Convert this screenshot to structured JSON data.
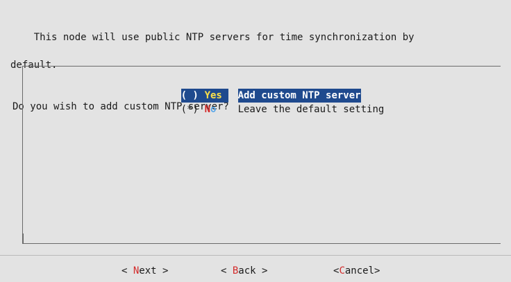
{
  "message": {
    "line1": "This node will use public NTP servers for time synchronization by",
    "line2": "default.",
    "line3": "Do you wish to add custom NTP server?"
  },
  "options": [
    {
      "radio": "( )",
      "tag": "Yes",
      "description": "Add custom NTP server",
      "highlighted": true
    },
    {
      "radio": "(*)",
      "tag": "No",
      "description": "Leave the default setting",
      "highlighted": false
    }
  ],
  "buttons": {
    "next": {
      "prefix": "< ",
      "hot": "N",
      "rest": "ext",
      "suffix": " >"
    },
    "back": {
      "prefix": "< ",
      "hot": "B",
      "rest": "ack",
      "suffix": " >"
    },
    "cancel": {
      "prefix": "<",
      "hot": "C",
      "rest": "ancel",
      "suffix": ">"
    }
  },
  "colors": {
    "background": "#e3e3e3",
    "highlight": "#1f4a8e",
    "hotkey": "#d32a2a",
    "highlight_tag": "#ffe14a",
    "tag_alt": "#5aa7e8"
  }
}
